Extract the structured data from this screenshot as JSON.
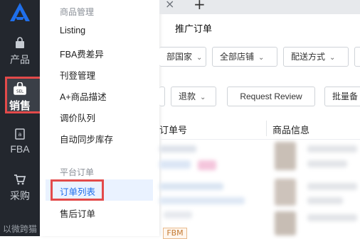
{
  "rail": {
    "items": [
      {
        "label": "产品",
        "icon": "bag-icon"
      },
      {
        "label": "销售",
        "icon": "sell-tag-icon",
        "active": true
      },
      {
        "label": "FBA",
        "icon": "amazon-icon"
      },
      {
        "label": "采购",
        "icon": "cart-icon"
      }
    ],
    "watermark": "以微跨猫"
  },
  "menu": {
    "group1_title": "商品管理",
    "items1": [
      "Listing",
      "FBA费差异",
      "刊登管理",
      "A+商品描述",
      "调价队列",
      "自动同步库存"
    ],
    "group2_title": "平台订单",
    "items2": [
      "订单列表",
      "售后订单"
    ],
    "selected": "订单列表"
  },
  "main": {
    "subtab": "推广订单",
    "filters": [
      "部国家",
      "全部店铺",
      "配送方式"
    ],
    "toolbar": {
      "refund": "退款",
      "request_review": "Request Review",
      "bulk": "批量备"
    },
    "table_headers": [
      "订单号",
      "商品信息"
    ],
    "fbm_badge": "FBM"
  },
  "colors": {
    "rail_bg": "#23272e",
    "highlight_frame": "#e34a4a",
    "menu_selected_text": "#1f6feb",
    "menu_selected_bg": "#eaf2ff"
  }
}
